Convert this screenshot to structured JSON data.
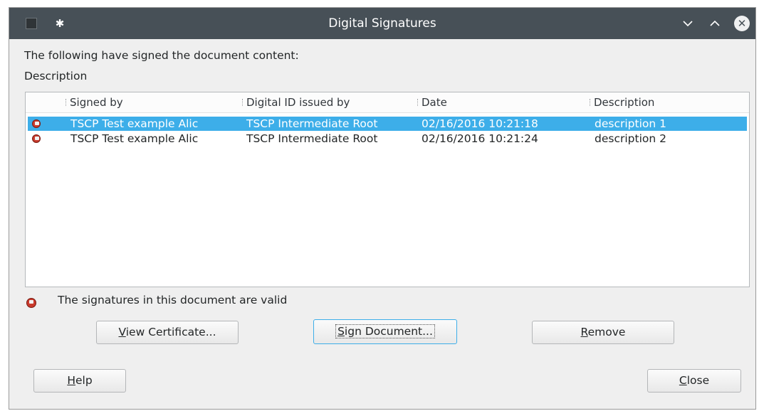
{
  "window": {
    "title": "Digital Signatures"
  },
  "intro_text": "The following have signed the document content:",
  "description_label": "Description",
  "list": {
    "columns": [
      "Signed by",
      "Digital ID issued by",
      "Date",
      "Description"
    ],
    "rows": [
      {
        "signed_by": "TSCP Test example Alic",
        "issued_by": "TSCP Intermediate Root",
        "date": "02/16/2016 10:21:18",
        "description": "description 1",
        "selected": true
      },
      {
        "signed_by": "TSCP Test example Alic",
        "issued_by": "TSCP Intermediate Root",
        "date": "02/16/2016 10:21:24",
        "description": "description 2",
        "selected": false
      }
    ]
  },
  "status": {
    "text": "The signatures in this document are valid",
    "icon": "signature-valid-icon"
  },
  "buttons": {
    "view_certificate": {
      "mnemonic": "V",
      "rest": "iew Certificate..."
    },
    "sign_document": {
      "mnemonic": "S",
      "rest": "ign Document..."
    },
    "remove": {
      "mnemonic": "R",
      "rest": "emove"
    },
    "help": {
      "mnemonic": "H",
      "rest": "elp"
    },
    "close": {
      "mnemonic": "C",
      "rest": "lose"
    }
  },
  "colors": {
    "titlebar": "#475057",
    "selection": "#3daee9",
    "window_bg": "#efefef"
  }
}
